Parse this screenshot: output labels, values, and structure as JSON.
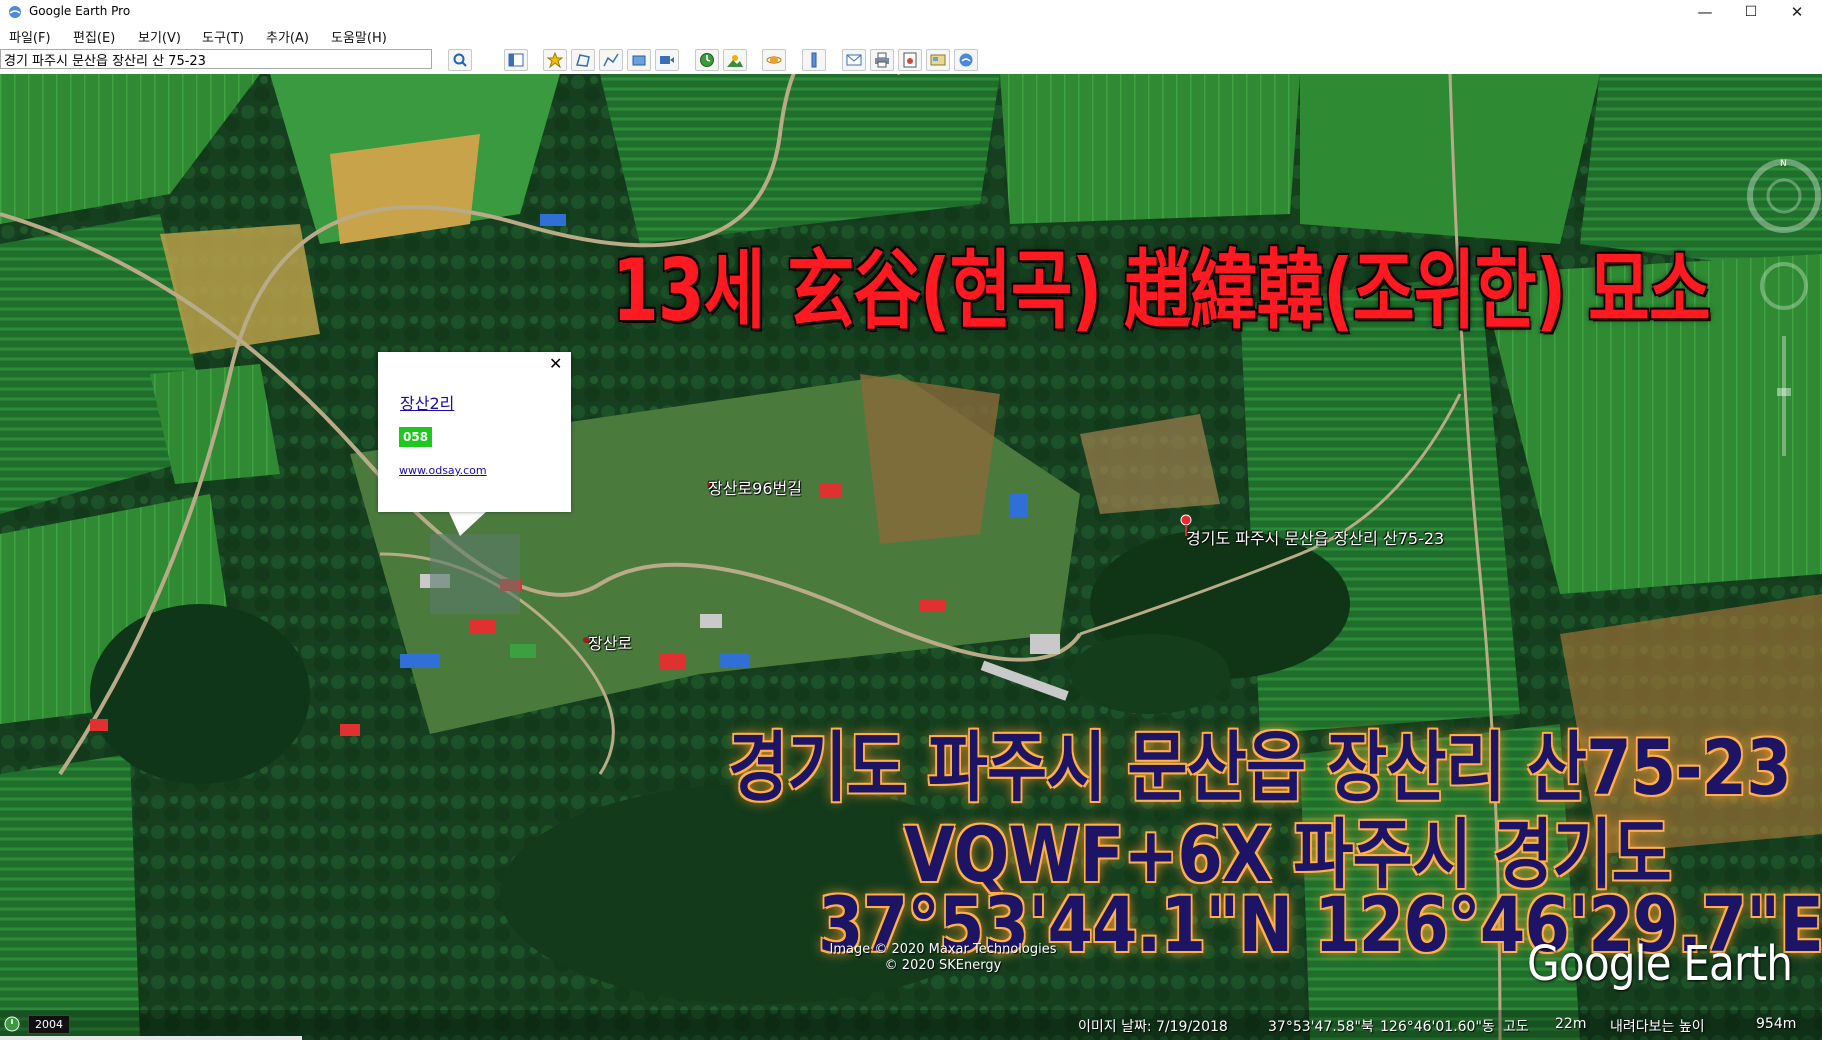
{
  "window": {
    "title": "Google Earth Pro",
    "minimize_glyph": "—",
    "maximize_glyph": "☐",
    "close_glyph": "✕"
  },
  "menu": [
    "파일(F)",
    "편집(E)",
    "보기(V)",
    "도구(T)",
    "추가(A)",
    "도움말(H)"
  ],
  "search": {
    "value": "경기 파주시 문산읍 장산리 산 75-23"
  },
  "toolbar_icons": [
    "search-icon",
    "sidebar-toggle-icon",
    "placemark-icon",
    "polygon-icon",
    "path-icon",
    "image-overlay-icon",
    "record-tour-icon",
    "historical-imagery-icon",
    "sunlight-icon",
    "planets-icon",
    "ruler-icon",
    "email-icon",
    "print-icon",
    "save-image-icon",
    "view-in-maps-icon",
    "sign-in-icon"
  ],
  "overlay": {
    "title": "13세 玄谷(현곡) 趙緯韓(조위한) 묘소",
    "address_line1": "경기도 파주시 문산읍 장산리 산75-23",
    "address_line2": "VQWF+6X 파주시 경기도",
    "address_line3": "37°53'44.1\"N 126°46'29.7\"E"
  },
  "map_labels": {
    "placemark": "경기도 파주시 문산읍 장산리 산75-23",
    "road1": "장산로96번길",
    "road2": "장산로"
  },
  "balloon": {
    "close_glyph": "✕",
    "title": "장산2리",
    "badge": "058",
    "link": "www.odsay.com"
  },
  "credits": {
    "line1": "Image © 2020 Maxar Technologies",
    "line2": "© 2020 SKEnergy"
  },
  "logo": "Google Earth",
  "status": {
    "year": "2004",
    "image_date": "이미지 날짜: 7/19/2018",
    "lat": "37°53'47.58\"북",
    "lon": "126°46'01.60\"동",
    "elev_label": "고도",
    "elev_value": "22m",
    "eye_label": "내려다보는 높이",
    "eye_value": "954m"
  },
  "colors": {
    "title_red": "#ff1a22",
    "address_navy": "#1d1466",
    "address_glow": "#ffb04a",
    "badge_green": "#1ec81e",
    "link_blue": "#1a0dab"
  }
}
